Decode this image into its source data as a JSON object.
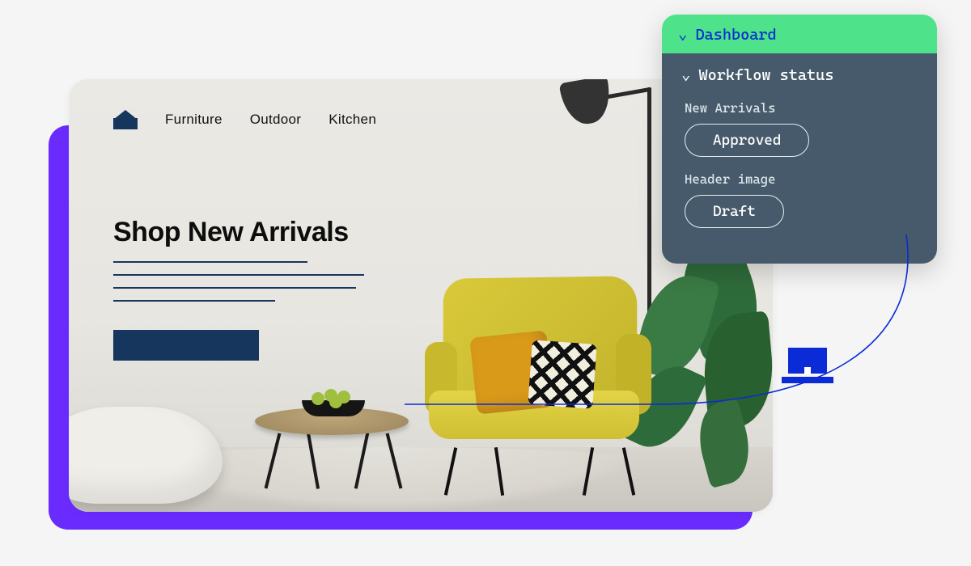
{
  "site": {
    "nav": {
      "items": [
        "Furniture",
        "Outdoor",
        "Kitchen"
      ]
    },
    "headline": "Shop New Arrivals"
  },
  "dashboard": {
    "title": "Dashboard",
    "section": "Workflow status",
    "statuses": [
      {
        "label": "New Arrivals",
        "value": "Approved"
      },
      {
        "label": "Header image",
        "value": "Draft"
      }
    ]
  },
  "colors": {
    "purple": "#6a2bff",
    "green": "#4ee28a",
    "slate": "#465a6b",
    "blue": "#0a2bd6",
    "navy": "#17365d"
  }
}
